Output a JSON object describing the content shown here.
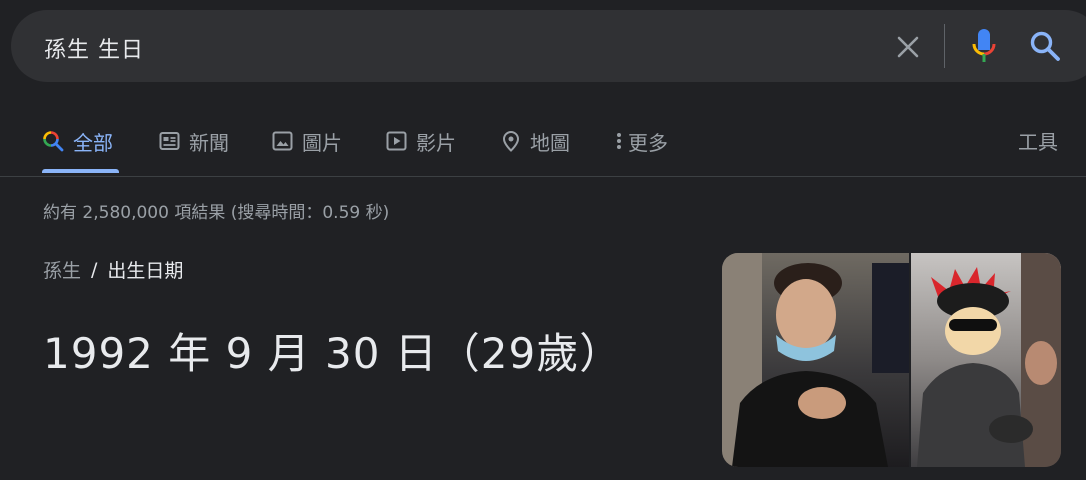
{
  "search": {
    "query": "孫生 生日"
  },
  "tabs": [
    {
      "label": "全部",
      "icon": "search-multicolor-icon",
      "active": true
    },
    {
      "label": "新聞",
      "icon": "news-icon"
    },
    {
      "label": "圖片",
      "icon": "image-icon"
    },
    {
      "label": "影片",
      "icon": "video-icon"
    },
    {
      "label": "地圖",
      "icon": "map-pin-icon"
    },
    {
      "label": "更多",
      "icon": "more-vert-icon"
    }
  ],
  "tools_label": "工具",
  "result_stats": "約有 2,580,000 項結果 (搜尋時間：0.59 秒)",
  "answer": {
    "breadcrumb_entity": "孫生",
    "breadcrumb_separator": "/",
    "breadcrumb_attribute": "出生日期",
    "value": "1992 年 9 月 30 日（29歲）"
  },
  "colors": {
    "background": "#202124",
    "search_bar": "#303134",
    "accent": "#8ab4f8",
    "muted_text": "#9aa0a6",
    "primary_text": "#e8eaed"
  }
}
